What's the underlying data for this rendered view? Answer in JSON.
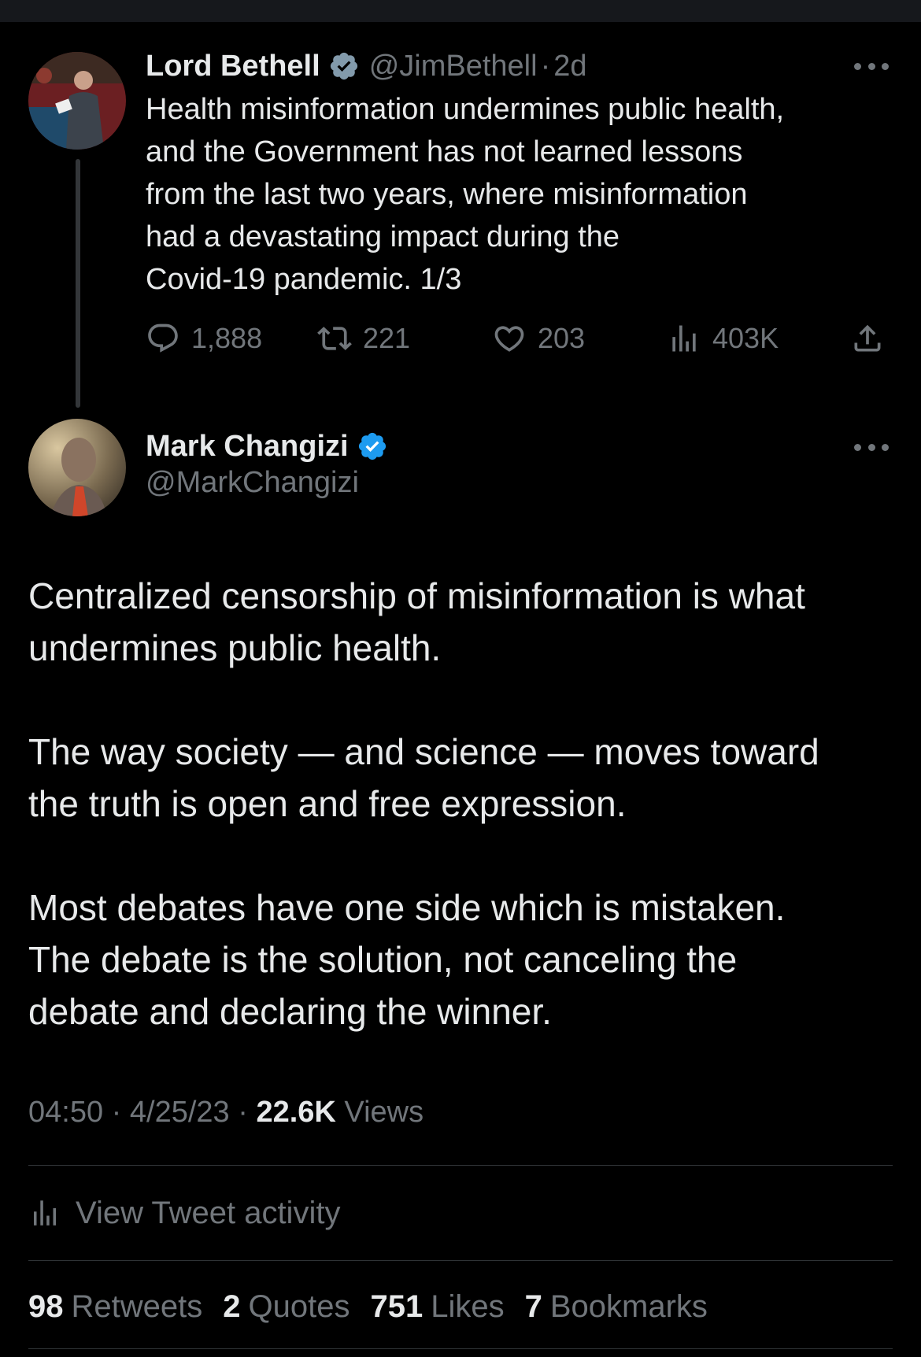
{
  "parent_tweet": {
    "display_name": "Lord Bethell",
    "handle": "@JimBethell",
    "separator": "·",
    "time_ago": "2d",
    "text_lines": [
      "Health misinformation undermines public health,",
      "and the Government has not learned lessons",
      "from the last two years, where misinformation",
      "had a devastating impact during the",
      "Covid-19 pandemic. 1/3"
    ],
    "replies": "1,888",
    "retweets": "221",
    "likes": "203",
    "views": "403K"
  },
  "main_tweet": {
    "display_name": "Mark Changizi",
    "handle": "@MarkChangizi",
    "paragraphs": [
      [
        "Centralized censorship of misinformation is what",
        "undermines public health."
      ],
      [
        "The way society — and science — moves toward",
        "the truth is open and free expression."
      ],
      [
        "Most debates have one side which is mistaken.",
        "The debate is the solution, not canceling the",
        "debate and declaring the winner."
      ]
    ],
    "time": "04:50",
    "date": "4/25/23",
    "separator": "·",
    "views_count": "22.6K",
    "views_label": "Views",
    "activity_label": "View Tweet activity",
    "stats": {
      "retweets_count": "98",
      "retweets_label": "Retweets",
      "quotes_count": "2",
      "quotes_label": "Quotes",
      "likes_count": "751",
      "likes_label": "Likes",
      "bookmarks_count": "7",
      "bookmarks_label": "Bookmarks"
    }
  },
  "colors": {
    "background": "#000000",
    "text_primary": "#e7e9ea",
    "text_secondary": "#71767b",
    "verified_blue": "#1d9bf0",
    "verified_gray": "#829aab",
    "divider": "#2f3336"
  },
  "icons": [
    "verified-badge-icon",
    "more-icon",
    "reply-icon",
    "retweet-icon",
    "like-icon",
    "views-icon",
    "share-icon",
    "activity-chart-icon"
  ]
}
